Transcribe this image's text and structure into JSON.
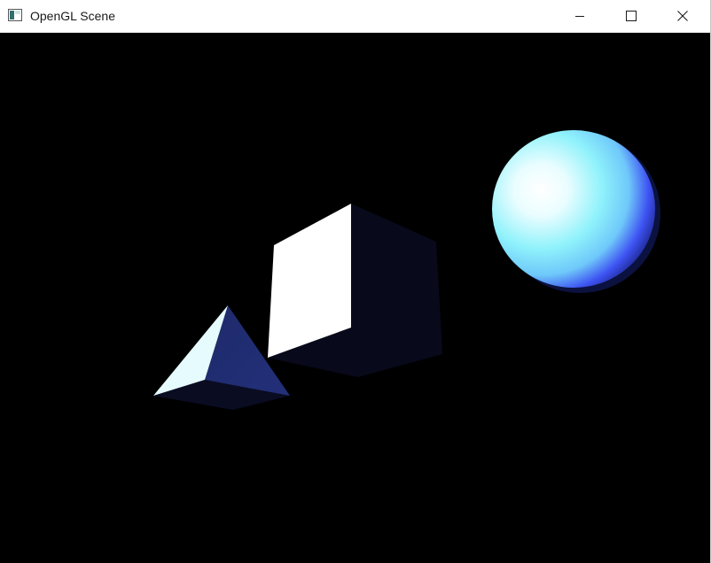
{
  "window": {
    "title": "OpenGL Scene",
    "icons": {
      "app": "opengl-app-icon",
      "minimize": "minimize-icon",
      "maximize": "maximize-icon",
      "close": "close-icon"
    }
  },
  "scene": {
    "background_color": "#000000",
    "objects": [
      "pyramid",
      "cube",
      "sphere"
    ],
    "colors": {
      "lit_face": "#ffffff",
      "pale_face": "#e6fbfd",
      "shadow_face": "#08091a",
      "pyramid_side": "#1e2a6e",
      "sphere_highlight": "#ffffff",
      "sphere_mid": "#7ff0fb",
      "sphere_rim": "#3a4ef0"
    }
  }
}
